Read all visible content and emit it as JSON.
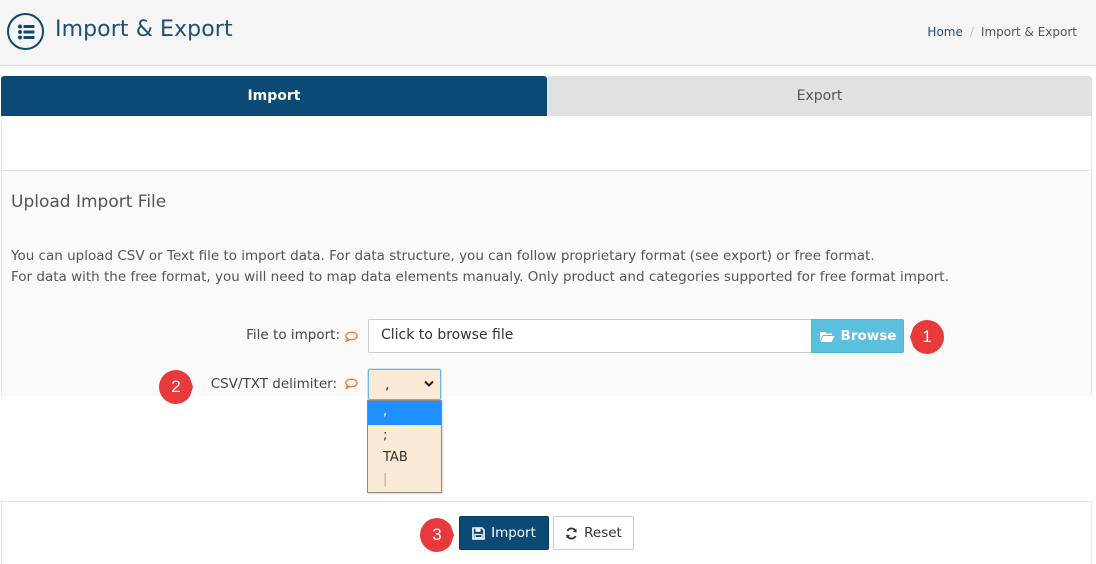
{
  "header": {
    "title": "Import & Export",
    "icon": "list-circle-icon",
    "breadcrumb": {
      "home": "Home",
      "separator": "/",
      "current": "Import & Export"
    }
  },
  "tabs": [
    {
      "label": "Import",
      "active": true
    },
    {
      "label": "Export",
      "active": false
    }
  ],
  "section": {
    "title": "Upload Import File",
    "description_line1": "You can upload CSV or Text file to import data. For data structure, you can follow proprietary format (see export) or free format.",
    "description_line2": "For data with the free format, you will need to map data elements manualy. Only product and categories supported for free format import."
  },
  "form": {
    "file_label": "File to import:",
    "file_placeholder": "Click to browse file",
    "browse_label": "Browse",
    "delimiter_label": "CSV/TXT delimiter:",
    "delimiter_value": ",",
    "delimiter_options": [
      ",",
      ";",
      "TAB",
      "|"
    ]
  },
  "actions": {
    "import_label": "Import",
    "reset_label": "Reset"
  },
  "steps": [
    "1",
    "2",
    "3"
  ],
  "colors": {
    "primary": "#0a4a74",
    "browse": "#5bc0de",
    "step_marker": "#e8393c",
    "help_icon": "#e87e2c",
    "select_bg": "#fbead6",
    "option_selected": "#1e90ff"
  }
}
